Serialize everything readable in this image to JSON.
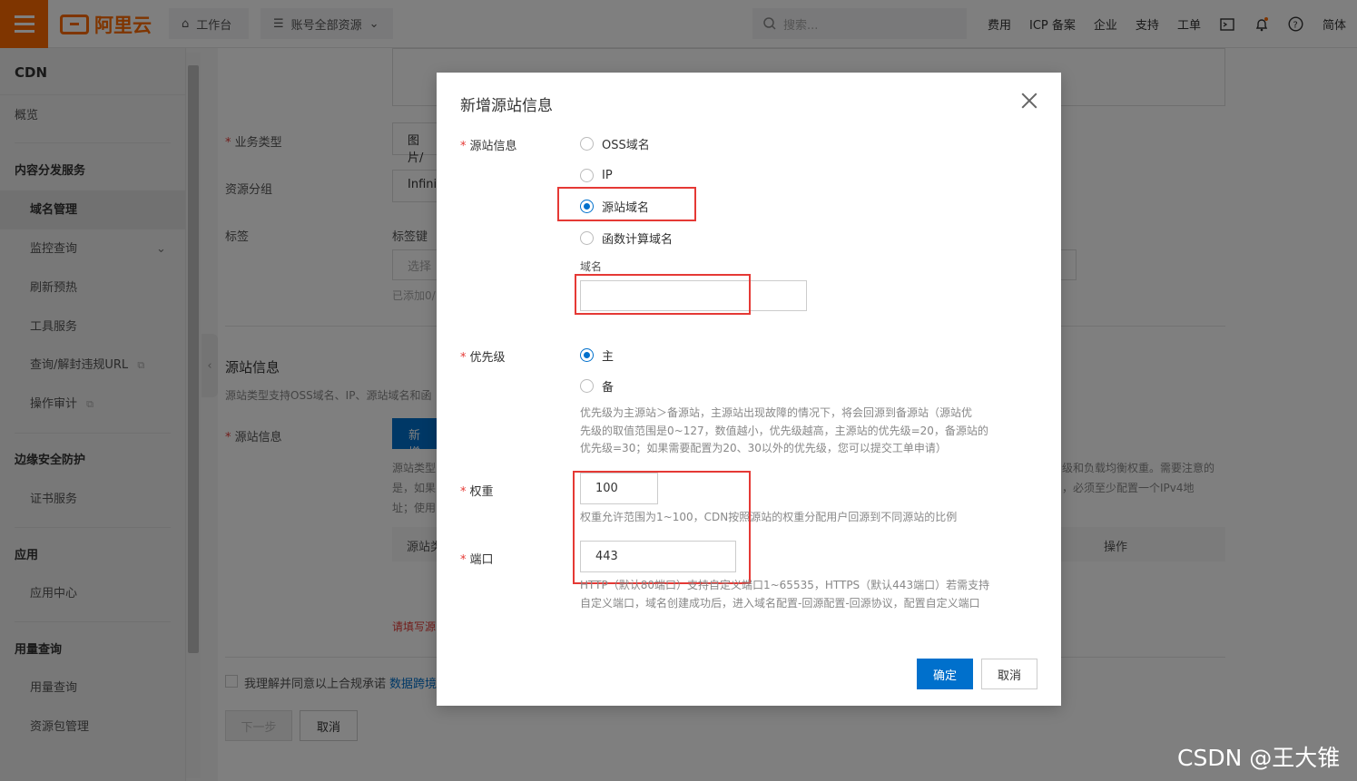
{
  "topbar": {
    "logo_text": "阿里云",
    "workbench": "工作台",
    "resources": "账号全部资源",
    "search_placeholder": "搜索...",
    "links": [
      "费用",
      "ICP 备案",
      "企业",
      "支持",
      "工单"
    ],
    "lang": "简体"
  },
  "sidebar": {
    "title": "CDN",
    "overview": "概览",
    "group_content": "内容分发服务",
    "domain_mgmt": "域名管理",
    "monitor": "监控查询",
    "refresh": "刷新预热",
    "tools": "工具服务",
    "illegal_url": "查询/解封违规URL",
    "audit": "操作审计",
    "group_edge": "边缘安全防护",
    "cert": "证书服务",
    "group_app": "应用",
    "app_center": "应用中心",
    "group_usage": "用量查询",
    "usage": "用量查询",
    "package": "资源包管理"
  },
  "background": {
    "business_type_label": "业务类型",
    "business_type_value": "图片/",
    "resource_group_label": "资源分组",
    "resource_group_value": "Infini",
    "tag_label": "标签",
    "tag_key": "标签键",
    "tag_select": "选择",
    "tag_added": "已添加0/",
    "origin_section_title": "源站信息",
    "origin_section_desc": "源站类型支持OSS域名、IP、源站域名和函",
    "origin_info_label": "源站信息",
    "add_btn": "新增",
    "desc_line1": "源站类型",
    "desc_line2": "是，如果",
    "desc_line3": "址；使用",
    "right_desc1": "级和负载均衡权重。需要注意的",
    "right_desc2": "，必须至少配置一个IPv4地",
    "table_col1": "源站类",
    "table_col_op": "操作",
    "error_text": "请填写源",
    "agree_text": "我理解并同意以上合规承诺",
    "agree_link": "数据跨境",
    "next_btn": "下一步",
    "cancel_btn": "取消"
  },
  "dialog": {
    "title": "新增源站信息",
    "origin_label": "源站信息",
    "origin_options": [
      "OSS域名",
      "IP",
      "源站域名",
      "函数计算域名"
    ],
    "origin_selected": "源站域名",
    "domain_label": "域名",
    "domain_value": "",
    "priority_label": "优先级",
    "priority_options": [
      "主",
      "备"
    ],
    "priority_selected": "主",
    "priority_help": [
      "优先级为主源站＞备源站，主源站出现故障的情况下，将会回源到备源站（源站优",
      "先级的取值范围是0~127，数值越小，优先级越高，主源站的优先级=20，备源站的",
      "优先级=30；如果需要配置为20、30以外的优先级，您可以提交工单申请）"
    ],
    "weight_label": "权重",
    "weight_value": "100",
    "weight_help": "权重允许范围为1~100，CDN按照源站的权重分配用户回源到不同源站的比例",
    "port_label": "端口",
    "port_value": "443",
    "port_help": [
      "HTTP（默认80端口）支持自定义端口1~65535，HTTPS（默认443端口）若需支持",
      "自定义端口，域名创建成功后，进入域名配置-回源配置-回源协议，配置自定义端口"
    ],
    "ok_btn": "确定",
    "cancel_btn": "取消"
  },
  "watermark": "CSDN @王大锥",
  "colors": {
    "brand": "#ff6a00",
    "primary": "#0070cc",
    "highlight": "#e53935"
  }
}
